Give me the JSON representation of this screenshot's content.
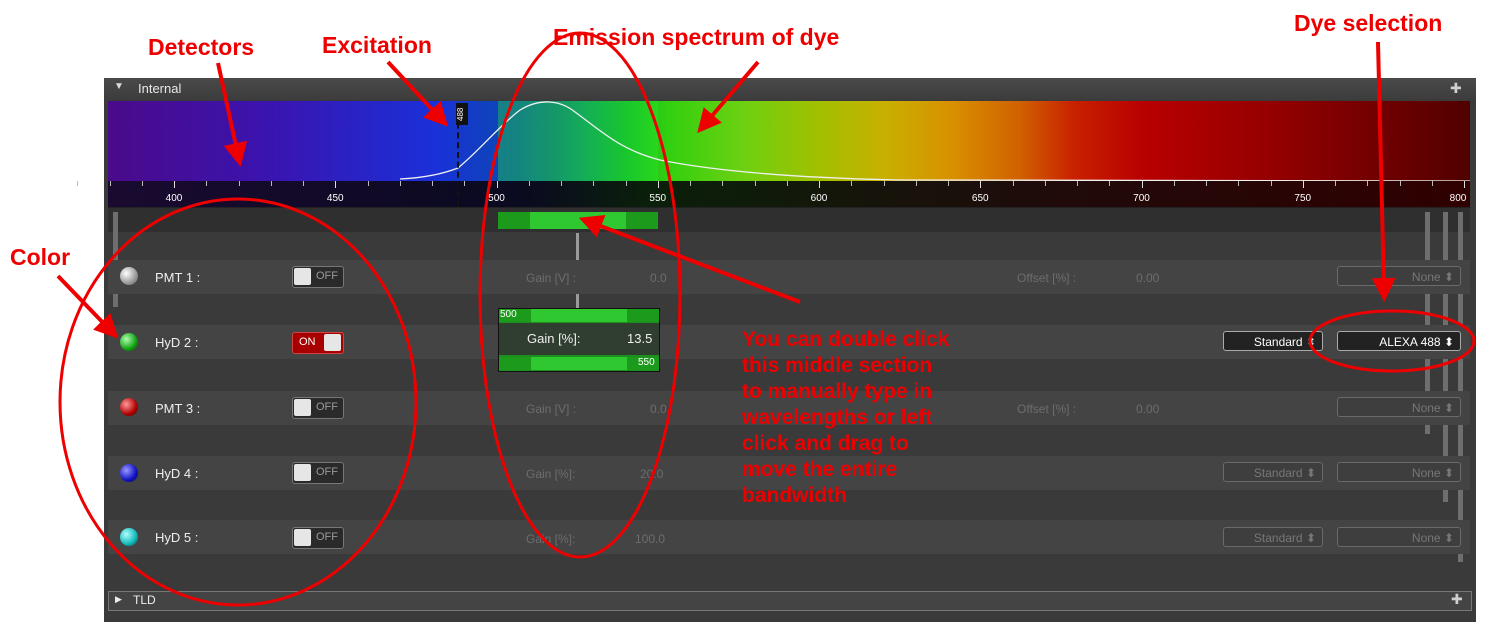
{
  "annotations": {
    "detectors": "Detectors",
    "excitation": "Excitation",
    "emission": "Emission spectrum of dye",
    "dye_selection": "Dye selection",
    "color": "Color",
    "instructions": "You can double click\nthis middle section\nto manually type in\nwavelengths or left\nclick and drag to\nmove the entire\nbandwidth"
  },
  "panel": {
    "title": "Internal",
    "collapse_icon": "triangle-down-icon",
    "pin_icon": "pin-icon"
  },
  "spectrum": {
    "excitation_laser": "488",
    "ticks": [
      "400",
      "450",
      "500",
      "550",
      "600",
      "650",
      "700",
      "750",
      "800"
    ]
  },
  "bandwidth": {
    "start": "500",
    "end": "550",
    "gain_label": "Gain [%]:",
    "gain_value": "13.5"
  },
  "detectors": [
    {
      "name": "PMT 1 :",
      "state": "OFF",
      "color": "#c8c8c8",
      "gain_label": "Gain [V] :",
      "gain_value": "0.0",
      "offset_label": "Offset [%] :",
      "offset_value": "0.00",
      "dye": "None"
    },
    {
      "name": "HyD 2 :",
      "state": "ON",
      "color": "#10b010",
      "mode": "Standard",
      "dye": "ALEXA 488"
    },
    {
      "name": "PMT 3 :",
      "state": "OFF",
      "color": "#b00000",
      "gain_label": "Gain [V] :",
      "gain_value": "0.0",
      "offset_label": "Offset [%] :",
      "offset_value": "0.00",
      "dye": "None"
    },
    {
      "name": "HyD 4 :",
      "state": "OFF",
      "color": "#1010c0",
      "gain_label": "Gain [%]:",
      "gain_value": "20.0",
      "mode": "Standard",
      "dye": "None"
    },
    {
      "name": "HyD 5 :",
      "state": "OFF",
      "color": "#10b8b8",
      "gain_label": "Gain [%]:",
      "gain_value": "100.0",
      "mode": "Standard",
      "dye": "None"
    }
  ],
  "tld": {
    "title": "TLD",
    "expand_icon": "triangle-right-icon"
  },
  "select_arrow": "⬍"
}
